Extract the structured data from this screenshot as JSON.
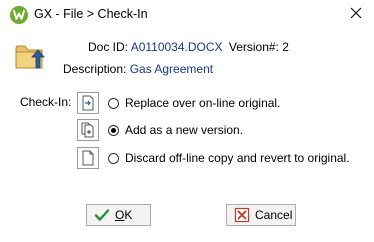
{
  "window": {
    "title": "GX - File > Check-In"
  },
  "header": {
    "doc_id_label": "Doc ID:",
    "doc_id_value": "A0110034.DOCX",
    "version_label": "Version#:",
    "version_value": "2",
    "description_label": "Description:",
    "description_value": "Gas Agreement"
  },
  "checkin": {
    "label": "Check-In:",
    "options": [
      {
        "label": "Replace over on-line original.",
        "icon": "replace-document-icon",
        "selected": false
      },
      {
        "label": "Add as a new version.",
        "icon": "new-version-icon",
        "selected": true
      },
      {
        "label": "Discard off-line copy and revert to original.",
        "icon": "blank-document-icon",
        "selected": false
      }
    ]
  },
  "buttons": {
    "ok_label": "OK",
    "cancel_label": "Cancel"
  },
  "colors": {
    "value_text": "#1a3a8a",
    "app_icon": "#6cab2f",
    "ok_check": "#2e8b3a",
    "cancel_x": "#c0392b"
  }
}
